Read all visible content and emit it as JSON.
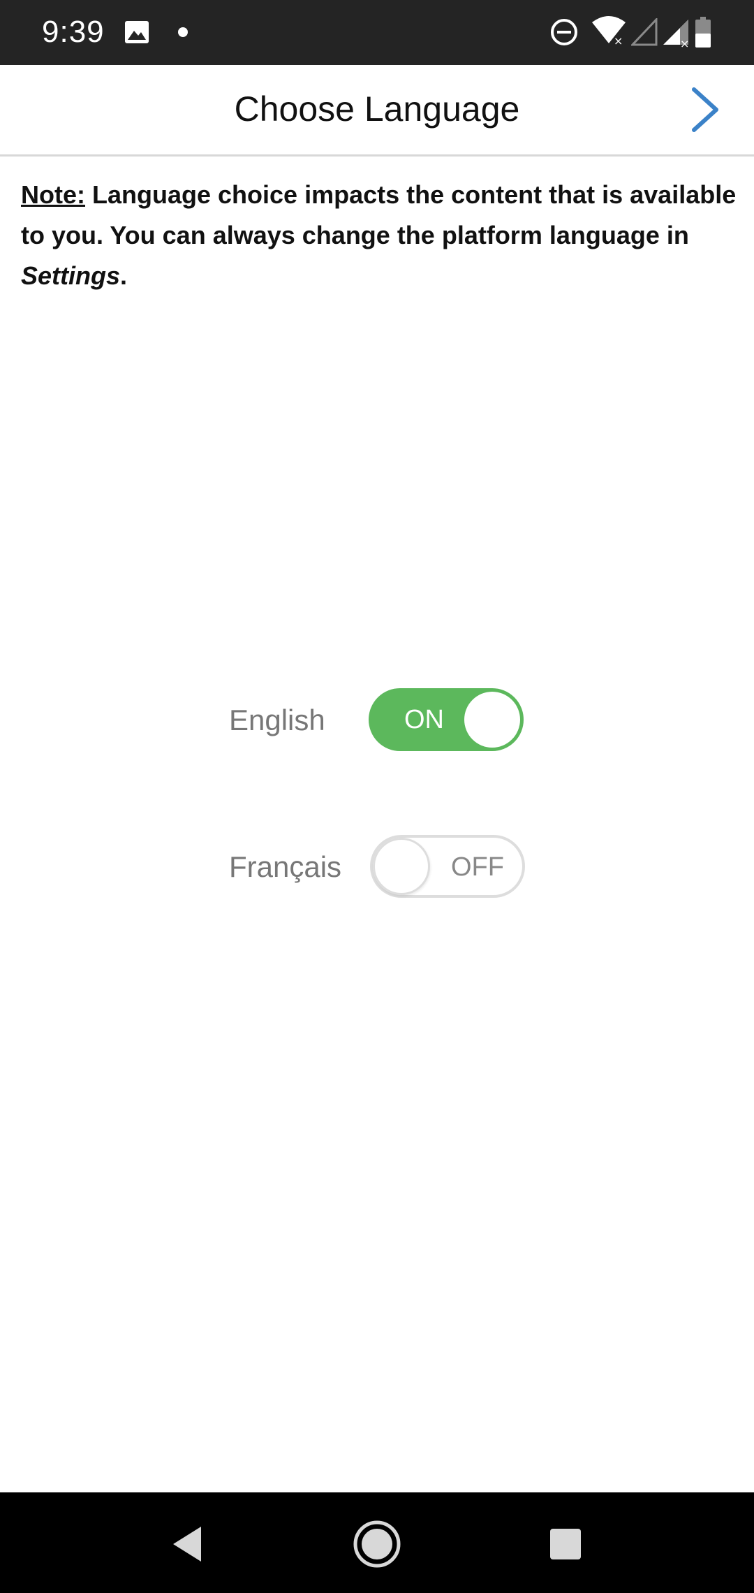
{
  "status_bar": {
    "time": "9:39",
    "icons": [
      "gallery-icon",
      "notification-dot-icon",
      "do-not-disturb-icon",
      "wifi-icon",
      "signal-icon",
      "signal-icon",
      "battery-icon"
    ]
  },
  "header": {
    "title": "Choose Language",
    "next_icon": "chevron-right-icon"
  },
  "note": {
    "label": "Note:",
    "text_before": " Language choice impacts the content that is available to you. You can always change the platform language in ",
    "settings_word": "Settings",
    "text_after": "."
  },
  "languages": [
    {
      "label": "English",
      "state": "ON",
      "enabled": true
    },
    {
      "label": "Français",
      "state": "OFF",
      "enabled": false
    }
  ],
  "colors": {
    "status_bar_bg": "#242424",
    "toggle_on": "#5cb85c",
    "toggle_off_border": "#dddddd",
    "accent_chevron": "#3b82c8",
    "nav_bar_bg": "#000000"
  },
  "nav_bar": {
    "icons": [
      "back-icon",
      "home-icon",
      "recents-icon"
    ]
  }
}
